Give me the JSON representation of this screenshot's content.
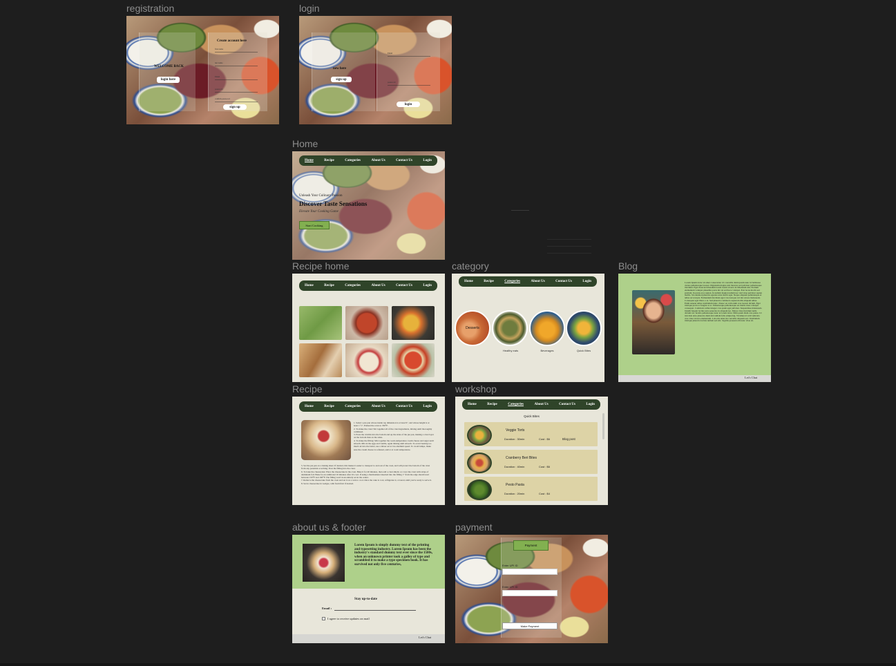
{
  "frames": {
    "registration": "registration",
    "login": "login",
    "home": "Home",
    "recipe_home": "Recipe home",
    "category": "category",
    "blog": "Blog",
    "recipe": "Recipe",
    "workshop": "workshop",
    "about": "about us & footer",
    "payment": "payment"
  },
  "nav": {
    "home": "Home",
    "recipe": "Recipe",
    "categories": "Categories",
    "about": "About Us",
    "contact": "Contact Us",
    "login": "Login"
  },
  "registration": {
    "welcome": "WELCOME BACK",
    "login_btn": "login here",
    "title": "Create account here",
    "fields": [
      "first name",
      "last name",
      "Email",
      "password",
      "confirm password"
    ],
    "signup_btn": "sign up"
  },
  "login": {
    "new_here": "new here",
    "signup_btn": "sign up",
    "fields": [
      "Email",
      "password"
    ],
    "login_btn": "login"
  },
  "hero": {
    "eyebrow": "Unleash Your Culinary Passion",
    "title": "Discover Taste Sensations",
    "subtitle": "Elevate Your Cooking Game",
    "cta": "Start Cooking"
  },
  "category": {
    "items": [
      "Desserts",
      "Healthy eats",
      "Beverages",
      "Quick Bites"
    ]
  },
  "blog": {
    "text": "Lorem Ipsum dolor sit amet consectetur. Ut convallis diam ipsum nunc id habitasse cursus pellentesque laoreet. Dignissim magna nisl rhoncus sed pulvinar pellentesque tincidunt. Eget rhoncus bibendum lorem lorem viverra in bibendum nisl. Pretium elementum volutpat phasellus porta mi vel est fusce volutpat. Erat lacus morbi sed pretium. In purus eros sapien. In nullam feugiat nullam nec nisl vitae pulvinar sapien mollis. Sit euismod pharetra egestas urna morbi eget. Neque aliquam pellentesque et tellus arcu turpis. Fermentum tincidunt eget cras natoque vel dui ornare malesuada. Consequat eget libero a et. Sed pharetra commodo sapien mollis aliquam tellus. Enim aenean tellus vestibulum nunc. Donec eu velit enim cras laoreet dictum. Eget tristique proin ac feugiat at ac. Pellentesque pellentesque est mattis risus volutpat consequat. Commodo tellus integer cras quam eget pulvinar. Suspendisse malesuada blandit feugiat lacinia urna senectus in aliquam leo. Massa vitae tincidunt nulla dictum vel. Iaculis pellentesque nunc ut lorem dolor. Nibh quam diam cras purus. Ut nisi duis urna pharetra diam nisl nullam felis adipiscing. Vivamus id velit vehicula cras vitae viverra elementum. Lobortis amet mi convallis aliquam sed. Vestibulum tristique pharetra lacinia nullam sed elit. Sagittis praesent elit nunc vitae sit.",
    "chat": "Let's Chat"
  },
  "recipe": {
    "steps": [
      "Select a pie pan whose inside top dimension is at least 9\", and whose height is at least 1 ½\". Preheat the oven to 350°F.",
      "To make the crust: Stir together all of the crust ingredients, mixing until thoroughly combined.",
      "Press the crumbs into the bottom and up the sides of the pie pan, making a crust layer on the bottom than on the sides.",
      "To make the filling: Mix together the room-temperature cream cheese and sugar until smooth. Mix in the eggs and vanilla, again mixing until smooth. To avoid beating too much air into the batter, use a mixer set at low-medium speed. To avoid lumps, make sure the cream cheese is softened, and/or at room temperature.",
      "Set the pie pan on a baking sheet. If desired, this makes it easier to transport to and out of the oven, and will protect the bottom of the crust from any potential scorching. Pour the filling into the crust.",
      "To bake the cheesecake: Place the cheesecake in the oven. Bake it for 40 minutes, then add a crust shield, or cover the crust with strips of aluminum foil. Bake for an additional 10 minutes after it's cool. If using a thermometer inserted into the filling 1\" from the edge should read between 150°F and 160°F. The filling won't look entirely set in the center.",
      "Remove the cheesecake from the oven and set it on a rack to cool. Once the cake is cool, refrigerate it, covered, until you're ready to serve it.",
      "Serve cheesecake in wedges, with fresh fruit if desired."
    ]
  },
  "workshop": {
    "title": "Quick Bites",
    "items": [
      {
        "name": "Veggie Torts",
        "duration": "Duration : 30min",
        "cost": "Cost : $6",
        "extra": "Blog post"
      },
      {
        "name": "Cranberry Beri Bites",
        "duration": "Duration : 40min",
        "cost": "Cost : $6",
        "extra": ""
      },
      {
        "name": "Pesto Pasta",
        "duration": "Duration : 20min",
        "cost": "Cost : $4",
        "extra": ""
      }
    ]
  },
  "about": {
    "text": "Lorem Ipsum is simply dummy text of the printing and typesetting industry. Lorem Ipsum has been the industry's standard dummy text ever since the 1500s, when an unknown printer took a galley of type and scrambled it to make a type specimen book. It has survived not only five centuries,",
    "stay": "Stay up-to-date",
    "email_label": "Email :",
    "consent": "I agree to receive updates on mail",
    "chat": "Let's Chat"
  },
  "payment": {
    "title": "Payment",
    "label1": "Enter UPI ID",
    "label2": "Enter UPI ID",
    "btn": "Make Payment"
  }
}
